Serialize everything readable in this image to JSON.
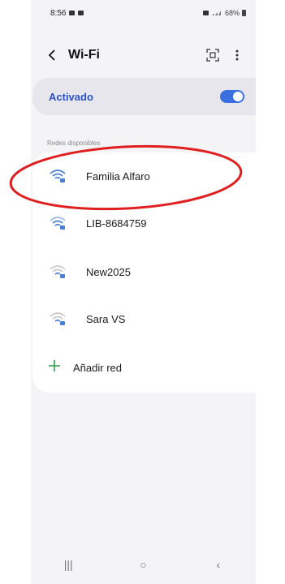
{
  "status_bar": {
    "time": "8:56",
    "battery": "68%"
  },
  "header": {
    "title": "Wi-Fi"
  },
  "wifi_toggle": {
    "label": "Activado",
    "state": "on",
    "accent_color": "#3b6fe0"
  },
  "section": {
    "label": "Redes disponibles"
  },
  "networks": [
    {
      "name": "Familia Alfaro",
      "icon": "wifi-secured-icon",
      "signal": "strong"
    },
    {
      "name": "LIB-8684759",
      "icon": "wifi-secured-icon",
      "signal": "medium"
    },
    {
      "name": "New2025",
      "icon": "wifi-secured-icon",
      "signal": "weak"
    },
    {
      "name": "Sara VS",
      "icon": "wifi-secured-icon",
      "signal": "weak"
    }
  ],
  "add_network": {
    "label": "Añadir red",
    "icon": "plus-icon"
  },
  "annotation": {
    "color": "#e02020",
    "shape": "ellipse"
  },
  "nav": {
    "recent": "|||",
    "home": "○",
    "back": "‹"
  }
}
